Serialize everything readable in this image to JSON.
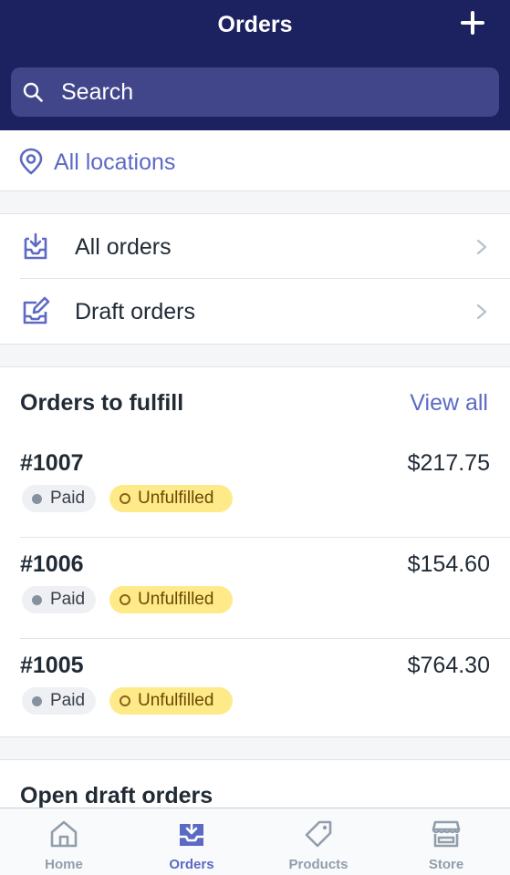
{
  "header": {
    "title": "Orders"
  },
  "search": {
    "placeholder": "Search"
  },
  "location": {
    "label": "All locations"
  },
  "nav": {
    "all_orders": "All orders",
    "draft_orders": "Draft orders"
  },
  "fulfill": {
    "title": "Orders to fulfill",
    "view_all": "View all",
    "orders": [
      {
        "number": "#1007",
        "total": "$217.75",
        "payment": "Paid",
        "fulfillment": "Unfulfilled"
      },
      {
        "number": "#1006",
        "total": "$154.60",
        "payment": "Paid",
        "fulfillment": "Unfulfilled"
      },
      {
        "number": "#1005",
        "total": "$764.30",
        "payment": "Paid",
        "fulfillment": "Unfulfilled"
      }
    ]
  },
  "drafts": {
    "title": "Open draft orders"
  },
  "tabs": [
    {
      "label": "Home",
      "icon": "home-icon",
      "active": false
    },
    {
      "label": "Orders",
      "icon": "orders-icon",
      "active": true
    },
    {
      "label": "Products",
      "icon": "tag-icon",
      "active": false
    },
    {
      "label": "Store",
      "icon": "store-icon",
      "active": false
    }
  ],
  "colors": {
    "header_bg": "#1c2260",
    "search_bg": "#41468a",
    "accent": "#5c6ac4",
    "unfulfilled_badge": "#ffea8a",
    "paid_badge": "#eef0f4"
  }
}
